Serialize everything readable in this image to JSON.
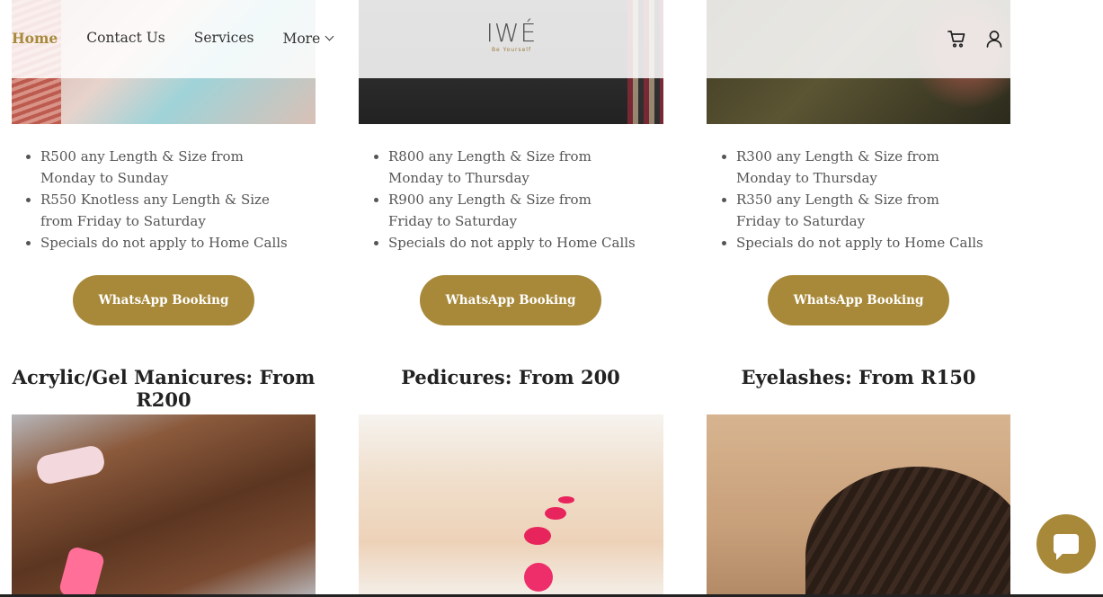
{
  "nav": {
    "items": [
      {
        "label": "Home"
      },
      {
        "label": "Contact Us"
      },
      {
        "label": "Services"
      },
      {
        "label": "More"
      }
    ]
  },
  "logo": {
    "mark": "IWÉ",
    "tagline": "Be Yourself"
  },
  "header_icons": [
    "cart-icon",
    "account-icon"
  ],
  "pricing_columns": [
    {
      "items": [
        "R500 any Length & Size  from Monday to Sunday",
        "R550 Knotless any Length & Size  from Friday to Saturday",
        "Specials do not apply to Home Calls"
      ],
      "button": "WhatsApp Booking"
    },
    {
      "items": [
        "R800 any Length & Size  from Monday to Thursday",
        "R900 any Length & Size  from Friday to Saturday",
        "Specials do not apply to Home Calls"
      ],
      "button": "WhatsApp Booking"
    },
    {
      "items": [
        "R300 any Length & Size  from Monday to Thursday",
        "R350 any Length & Size  from Friday to Saturday",
        "Specials do not apply to Home Calls"
      ],
      "button": "WhatsApp Booking"
    }
  ],
  "services": [
    {
      "title": "Acrylic/Gel Manicures: From R200"
    },
    {
      "title": "Pedicures: From 200"
    },
    {
      "title": "Eyelashes: From R150"
    }
  ],
  "colors": {
    "accent": "#a8893a",
    "text": "#555555",
    "heading": "#222222"
  },
  "chat_icon": "chat-bubble-icon"
}
